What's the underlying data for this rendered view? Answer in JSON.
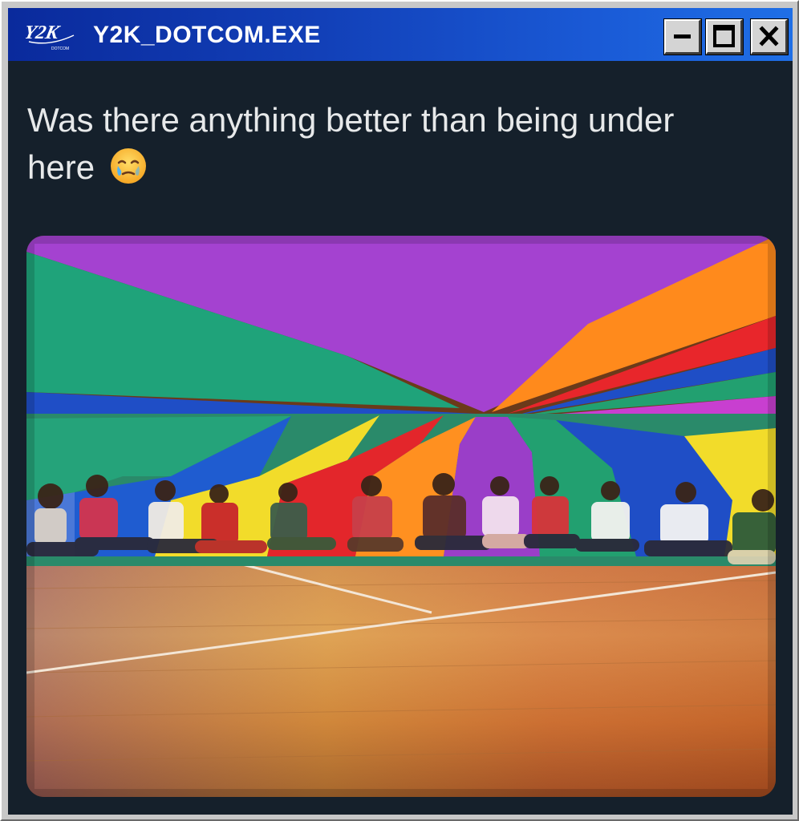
{
  "window": {
    "title": "Y2K_DOTCOM.EXE",
    "logo_text": "Y2K",
    "logo_subtext": "DOTCOM",
    "controls": {
      "minimize_icon": "minimize-icon",
      "maximize_icon": "maximize-icon",
      "close_icon": "close-icon"
    }
  },
  "post": {
    "text": "Was there anything better than being under here",
    "emoji": "face-holding-back-tears",
    "image_icon": "photo-rainbow-parachute"
  },
  "colors": {
    "titlebar_start": "#0a2a9c",
    "titlebar_end": "#1f6fe6",
    "content_bg": "#15202b",
    "text": "#e7e9ea"
  }
}
